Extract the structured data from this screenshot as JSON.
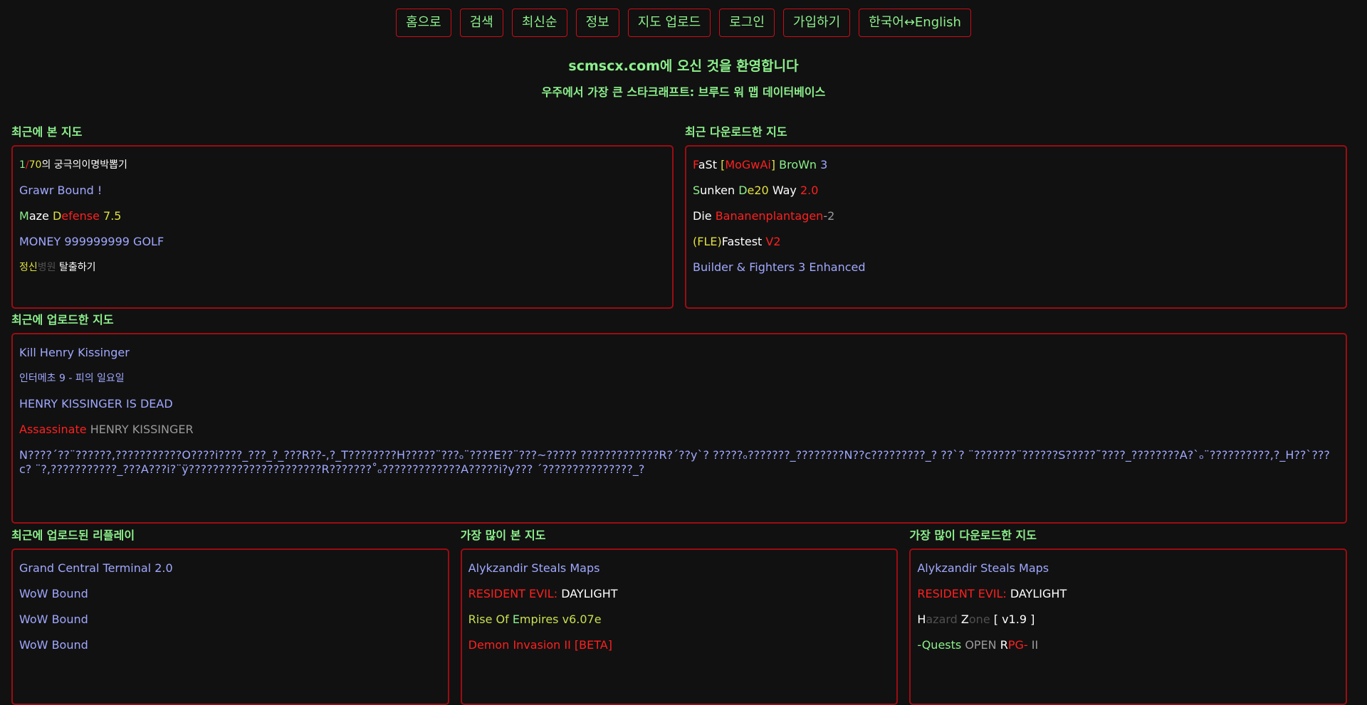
{
  "nav": [
    "홈으로",
    "검색",
    "최신순",
    "정보",
    "지도 업로드",
    "로그인",
    "가입하기",
    "한국어↔English"
  ],
  "header": {
    "title": "scmscx.com에 오신 것을 환영합니다",
    "subtitle": "우주에서 가장 큰 스타크래프트: 브루드 워 맵 데이터베이스"
  },
  "sections": {
    "recent_viewed": {
      "title": "최근에 본 지도",
      "items": [
        [
          {
            "t": "1",
            "c": "c-green"
          },
          {
            "t": "/",
            "c": "c-red"
          },
          {
            "t": "70",
            "c": "c-yellow"
          },
          {
            "t": "의 궁극의이명박뽑기",
            "c": "c-white"
          }
        ],
        [
          {
            "t": "Grawr Bound !",
            "c": "c-blue"
          }
        ],
        [
          {
            "t": "M",
            "c": "c-green"
          },
          {
            "t": "aze ",
            "c": "c-white"
          },
          {
            "t": "D",
            "c": "c-yellow"
          },
          {
            "t": "efense ",
            "c": "c-red"
          },
          {
            "t": "7.5",
            "c": "c-yellow"
          }
        ],
        [
          {
            "t": "MONEY 999999999 GOLF",
            "c": "c-blue"
          }
        ],
        [
          {
            "t": "정신",
            "c": "c-yellow"
          },
          {
            "t": "병원 ",
            "c": "c-dgray"
          },
          {
            "t": "탈출하기",
            "c": "c-white"
          }
        ]
      ]
    },
    "recent_downloaded": {
      "title": "최근 다운로드한 지도",
      "items": [
        [
          {
            "t": "F",
            "c": "c-red"
          },
          {
            "t": "aSt ",
            "c": "c-white"
          },
          {
            "t": "[",
            "c": "c-yellow"
          },
          {
            "t": "MoGwAi",
            "c": "c-red"
          },
          {
            "t": "] ",
            "c": "c-yellow"
          },
          {
            "t": "BroWn ",
            "c": "c-green"
          },
          {
            "t": "3",
            "c": "c-blue"
          }
        ],
        [
          {
            "t": "S",
            "c": "c-green"
          },
          {
            "t": "unken ",
            "c": "c-white"
          },
          {
            "t": "D",
            "c": "c-green"
          },
          {
            "t": "e20 ",
            "c": "c-yellow"
          },
          {
            "t": "Way ",
            "c": "c-white"
          },
          {
            "t": "2.0",
            "c": "c-red"
          }
        ],
        [
          {
            "t": "Die ",
            "c": "c-white"
          },
          {
            "t": "Bananenplantagen",
            "c": "c-red"
          },
          {
            "t": "-2",
            "c": "c-gray"
          }
        ],
        [
          {
            "t": "(FLE)",
            "c": "c-yellow"
          },
          {
            "t": "Fastest ",
            "c": "c-white"
          },
          {
            "t": "V2",
            "c": "c-red"
          }
        ],
        [
          {
            "t": "Builder & Fighters 3 Enhanced",
            "c": "c-blue"
          }
        ]
      ]
    },
    "recent_uploaded": {
      "title": "최근에 업로드한 지도",
      "items": [
        [
          {
            "t": "Kill Henry Kissinger",
            "c": "c-blue"
          }
        ],
        [
          {
            "t": "인터메초 9 - 피의 일요일",
            "c": "c-blue"
          }
        ],
        [
          {
            "t": "HENRY KISSINGER IS DEAD",
            "c": "c-blue"
          }
        ],
        [
          {
            "t": "Assassinate ",
            "c": "c-red"
          },
          {
            "t": "HENRY KISSINGER",
            "c": "c-gray"
          }
        ],
        [
          {
            "t": "N????´??¨??????,???????????O????i????_???_?_???R??-,?_T????????H?????¨???ₒ¨????E??¨???~????? ?????????????R?´??y`? ?????ₒ???????_????????N??c?????????_? ??`? ¨???????¨??????S?????˜????_????????A?`ₒ¨??????????,?_H??`???c? ¨?,???????????_???A???i?¨ÿ??????????????????????R???????˚ₒ?????????????A?????i?y??? ´???????????????_?",
            "c": "c-blue"
          }
        ]
      ]
    },
    "recent_replays": {
      "title": "최근에 업로드된 리플레이",
      "items": [
        [
          {
            "t": "Grand Central Terminal 2.0",
            "c": "c-blue"
          }
        ],
        [
          {
            "t": "WoW Bound",
            "c": "c-blue"
          }
        ],
        [
          {
            "t": "WoW Bound",
            "c": "c-blue"
          }
        ],
        [
          {
            "t": "WoW Bound",
            "c": "c-blue"
          }
        ]
      ]
    },
    "most_viewed": {
      "title": "가장 많이 본 지도",
      "items": [
        [
          {
            "t": "Alykzandir Steals Maps",
            "c": "c-blue"
          }
        ],
        [
          {
            "t": "RESIDENT EVIL: ",
            "c": "c-red"
          },
          {
            "t": "DAYLIGHT",
            "c": "c-white"
          }
        ],
        [
          {
            "t": "Rise Of ",
            "c": "c-lime"
          },
          {
            "t": "E",
            "c": "c-green"
          },
          {
            "t": "mpires v6.07e",
            "c": "c-lime"
          }
        ],
        [
          {
            "t": "Demon Invasion II [BETA]",
            "c": "c-red"
          }
        ]
      ]
    },
    "most_downloaded": {
      "title": "가장 많이 다운로드한 지도",
      "items": [
        [
          {
            "t": "Alykzandir Steals Maps",
            "c": "c-blue"
          }
        ],
        [
          {
            "t": "RESIDENT EVIL: ",
            "c": "c-red"
          },
          {
            "t": "DAYLIGHT",
            "c": "c-white"
          }
        ],
        [
          {
            "t": "H",
            "c": "c-white"
          },
          {
            "t": "azard ",
            "c": "c-dgray"
          },
          {
            "t": "Z",
            "c": "c-white"
          },
          {
            "t": "one ",
            "c": "c-dgray"
          },
          {
            "t": "[ v1.9 ]",
            "c": "c-white"
          }
        ],
        [
          {
            "t": "-Quests ",
            "c": "c-green"
          },
          {
            "t": "OPEN ",
            "c": "c-gray"
          },
          {
            "t": "R",
            "c": "c-white"
          },
          {
            "t": "PG- ",
            "c": "c-red"
          },
          {
            "t": "II",
            "c": "c-gray"
          }
        ]
      ]
    }
  }
}
